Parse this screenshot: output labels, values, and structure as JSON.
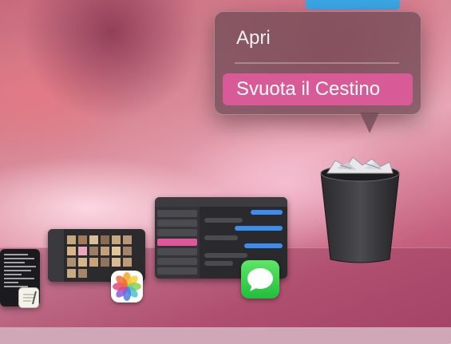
{
  "context_menu": {
    "items": [
      {
        "label": "Apri",
        "highlighted": false
      },
      {
        "label": "Svuota il Cestino",
        "highlighted": true
      }
    ],
    "highlight_color": "#d85a97"
  },
  "dock": {
    "items": [
      {
        "name": "Terminale",
        "icon": "terminal-window-thumbnail"
      },
      {
        "name": "Note",
        "icon": "notes-icon"
      },
      {
        "name": "Foto",
        "icon": "photos-icon"
      },
      {
        "name": "Messaggi",
        "icon": "messages-icon"
      },
      {
        "name": "Cestino",
        "icon": "trash-icon",
        "state": "full"
      }
    ]
  }
}
